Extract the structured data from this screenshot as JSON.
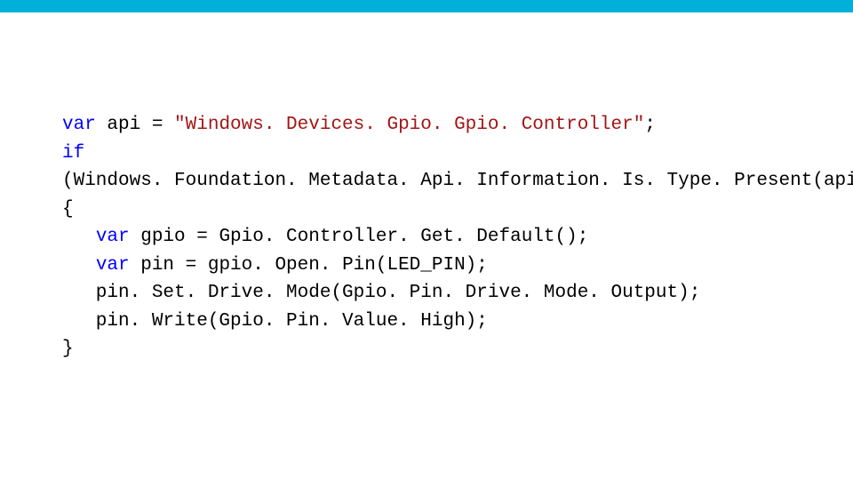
{
  "accent_color": "#00b0d8",
  "code": {
    "l1_kw": "var",
    "l1_rest": " api = ",
    "l1_str": "\"Windows. Devices. Gpio. Gpio. Controller\"",
    "l1_end": ";",
    "l2_kw": "if",
    "l3": "(Windows. Foundation. Metadata. Api. Information. Is. Type. Present(api))",
    "l4": "{",
    "l5_indent": "   ",
    "l5_kw": "var",
    "l5_rest": " gpio = Gpio. Controller. Get. Default();",
    "l6_indent": "   ",
    "l6_kw": "var",
    "l6_rest": " pin = gpio. Open. Pin(LED_PIN);",
    "l7": "   pin. Set. Drive. Mode(Gpio. Pin. Drive. Mode. Output);",
    "l8": "   pin. Write(Gpio. Pin. Value. High);",
    "l9": "}"
  }
}
